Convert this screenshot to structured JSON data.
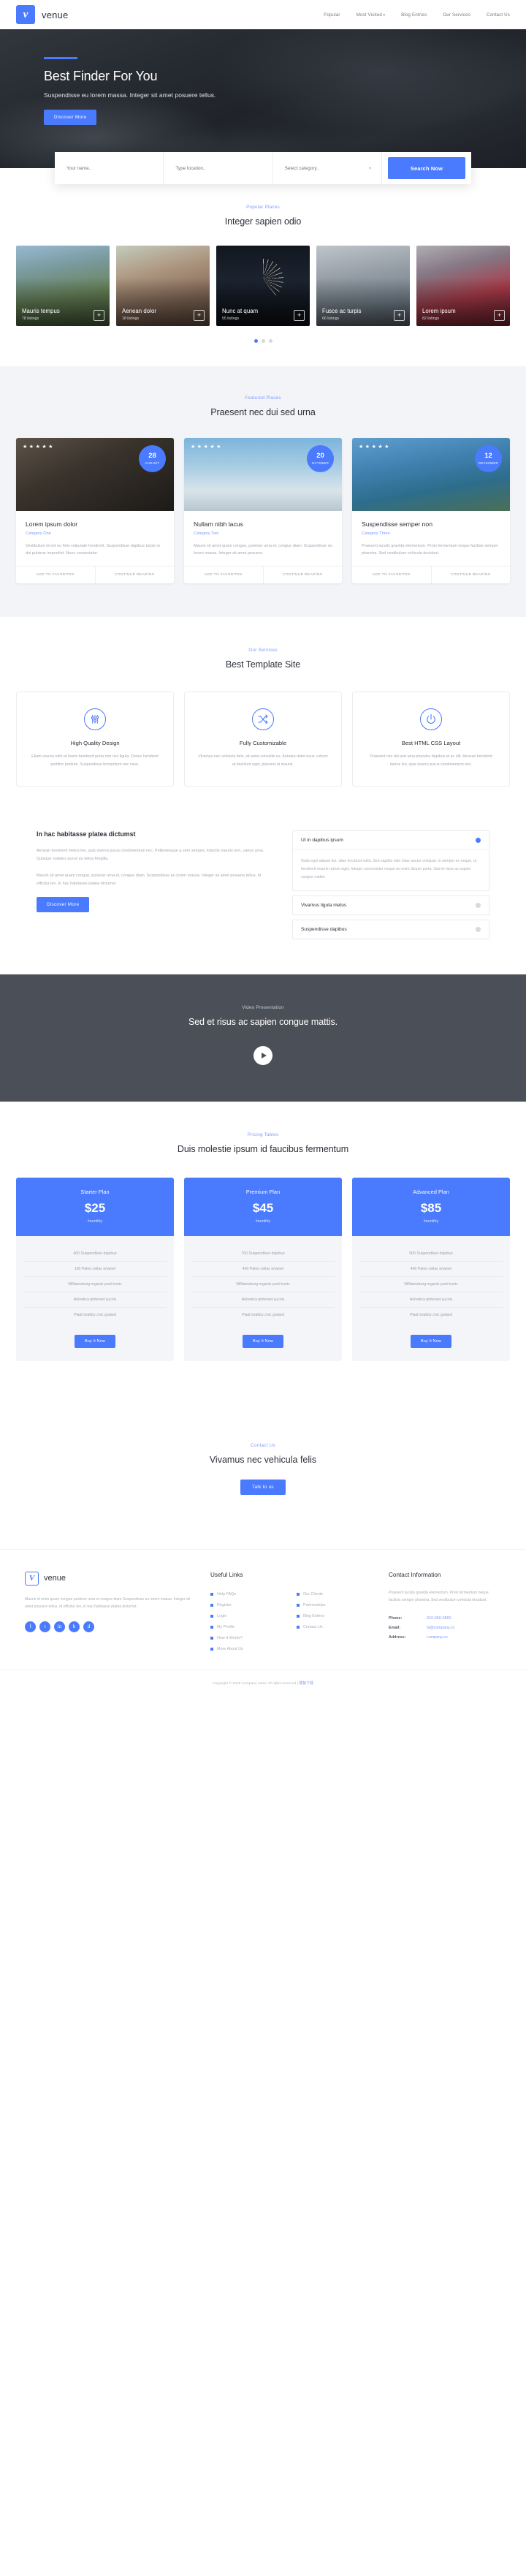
{
  "brand": {
    "name": "venue",
    "mark": "v"
  },
  "nav": [
    {
      "label": "Popular",
      "caret": false
    },
    {
      "label": "Most Visited",
      "caret": true
    },
    {
      "label": "Blog Entries",
      "caret": false
    },
    {
      "label": "Our Services",
      "caret": false
    },
    {
      "label": "Contact Us",
      "caret": false
    }
  ],
  "hero": {
    "title": "Best Finder For You",
    "subtitle": "Suspendisse eu lorem massa. Integer sit amet posuere tellus.",
    "cta": "Discover More"
  },
  "search": {
    "name_placeholder": "Your name..",
    "location_placeholder": "Type location..",
    "category_placeholder": "Select category..",
    "button": "Search Now"
  },
  "popular": {
    "eyebrow": "Popular Places",
    "title": "Integer sapien odio",
    "cards": [
      {
        "name": "Mauris tempus",
        "count": "78 listings",
        "theme": "ph-mountain"
      },
      {
        "name": "Aenean dolor",
        "count": "18 listings",
        "theme": "ph-woman"
      },
      {
        "name": "Nunc at quam",
        "count": "55 listings",
        "theme": "ph-firework"
      },
      {
        "name": "Fusce ac turpis",
        "count": "66 listings",
        "theme": "ph-group"
      },
      {
        "name": "Lorem ipsum",
        "count": "82 listings",
        "theme": "ph-smoke"
      }
    ],
    "add_icon": "+",
    "dots": 3,
    "active_dot": 0
  },
  "featured": {
    "eyebrow": "Featured Places",
    "title": "Praesent nec dui sed urna",
    "favorites_label": "ADD TO FAVORITES",
    "continue_label": "CONTINUE READING",
    "cards": [
      {
        "stars": 5,
        "badge_day": "28",
        "badge_month": "AUGUST",
        "title": "Lorem ipsum dolor",
        "category": "Category One",
        "desc": "Vestibulum id est eu felis vulputate hendrerit. Suspendisse dapibus turpis in dui pulvinar imperdiet. Nunc consectetur.",
        "theme": "fi-camera"
      },
      {
        "stars": 5,
        "badge_day": "20",
        "badge_month": "OCTOBER",
        "title": "Nullam nibh lacus",
        "category": "Category Two",
        "desc": "Mauris sit amet quam congue, pulvinar urna et, congue diam. Suspendisse eu lorem massa. Integer sit amet posuere.",
        "theme": "fi-tower"
      },
      {
        "stars": 5,
        "badge_day": "12",
        "badge_month": "DECEMBER",
        "title": "Suspendisse semper non",
        "category": "Category Three",
        "desc": "Praesent iaculis gravida elementum. Proin fermentum neque facilisis semper pharetra. Sed vestibulum vehicula tincidunt.",
        "theme": "fi-lake"
      }
    ]
  },
  "services": {
    "eyebrow": "Our Services",
    "title": "Best Template Site",
    "cards": [
      {
        "icon": "sliders-icon",
        "title": "High Quality Design",
        "desc": "Etiam viverra nibh at lorem hendrerit porta non nec ligula. Donec hendrerit porttitor pretium. Suspendisse fermentum nec risus."
      },
      {
        "icon": "shuffle-icon",
        "title": "Fully Customizable",
        "desc": "Vivamus nec vehicula felis, sit amet convallis ex. Aenean dolor risus, rutrum at tincidunt eget, placerat at mauris."
      },
      {
        "icon": "power-icon",
        "title": "Best HTML CSS Layout",
        "desc": "Praesent nec dui sed urna pharetra dapibus at ac elit. Aenean hendrerit metus leo, quis viverra purus condimentum nec."
      }
    ]
  },
  "accordion_section": {
    "heading": "In hac habitasse platea dictumst",
    "paragraph1": "Aenean hendrerit metus leo, quis viverra purus condimentum nec. Pellentesque a sem semper, lobortis mauris non, varius urna. Quisque sodales purus eu tellus fringilla.",
    "paragraph2": "Mauris sit amet quam congue, pulvinar urna et, congue diam. Suspendisse eu lorem massa. Integer sit amet posuere tellus, id efficitur leo. In hac habitasse platea dictumst.",
    "cta": "Discover More",
    "items": [
      {
        "title": "Ut in dapibus ipsum",
        "open": true,
        "body": "Nulla eget aliquet dui, vitae tincidunt nulla. Sed sagittis odio vitae auctor volutpat. In semper ex neque, ut hendrerit mauris rutrum eget. Integer consectetur neque eu enim dictum porta. Sed et risus ac sapien congue mattis."
      },
      {
        "title": "Vivamus ligula metus",
        "open": false,
        "body": ""
      },
      {
        "title": "Suspendisse dapibus",
        "open": false,
        "body": ""
      }
    ]
  },
  "video": {
    "eyebrow": "Video Presentation",
    "title": "Sed et risus ac sapien congue mattis.",
    "play_icon": "play-icon"
  },
  "pricing": {
    "eyebrow": "Pricing Tables",
    "title": "Duis molestie ipsum id faucibus fermentum",
    "buy_label": "Buy It Now",
    "plans": [
      {
        "plan": "Starter Plan",
        "price": "$25",
        "period": "/monthly",
        "features": [
          "400 Suspendisse dapibus",
          "100 Paleo cellac enamel",
          "Williamsburg organic post ironic",
          "Helvetica pinterest yuccie",
          "Plaid shabby chic godard"
        ]
      },
      {
        "plan": "Premium Plan",
        "price": "$45",
        "period": "/monthly",
        "features": [
          "700 Suspendisse dapibus",
          "440 Paleo cellac enamel",
          "Williamsburg organic post ironic",
          "Helvetica pinterest yuccie",
          "Plaid shabby chic godard"
        ]
      },
      {
        "plan": "Advanced Plan",
        "price": "$85",
        "period": "/monthly",
        "features": [
          "900 Suspendisse dapibus",
          "440 Paleo cellac enamel",
          "Williamsburg organic post ironic",
          "Helvetica pinterest yuccie",
          "Plaid shabby chic godard"
        ]
      }
    ]
  },
  "cta": {
    "eyebrow": "Contact Us",
    "title": "Vivamus nec vehicula felis",
    "button": "Talk to us"
  },
  "footer": {
    "brand_name": "venue",
    "brand_mark": "V",
    "about": "Mauris id enim quam congue pulvinar urna et congue diam Suspendisse eu lorem massa. Integer sit amet posuere tellus, id efficitur leo, in hac habitasse platea dictumst.",
    "socials": [
      "f",
      "t",
      "in",
      "b",
      "d"
    ],
    "links_title": "Useful Links",
    "links_col1": [
      "Help FAQs",
      "Register",
      "Login",
      "My Profile",
      "How It Works?",
      "More About Us"
    ],
    "links_col2": [
      "Our Clients",
      "Partnerships",
      "Blog Entries",
      "Contact Us"
    ],
    "contact_title": "Contact Information",
    "contact_text": "Praesent iaculis gravida elementum. Proin fermentum neque facilisis semper pharetra. Sed vestibulum vehicula tincidunt.",
    "contact_rows": [
      {
        "key": "Phone:",
        "value": "010-050-0560"
      },
      {
        "key": "Email:",
        "value": "hi@company.co"
      },
      {
        "key": "Address:",
        "value": "company.co"
      }
    ]
  },
  "copyright": {
    "text": "Copyright © 2048 Company name All rights reserved | ",
    "link": "模板下载"
  },
  "colors": {
    "accent": "#4a7afe",
    "eyebrow": "#7f9cfc",
    "heading": "#2c3038",
    "muted": "#a3a8b1",
    "featured_bg": "#f3f4f7",
    "video_bg": "#4b4f57"
  }
}
